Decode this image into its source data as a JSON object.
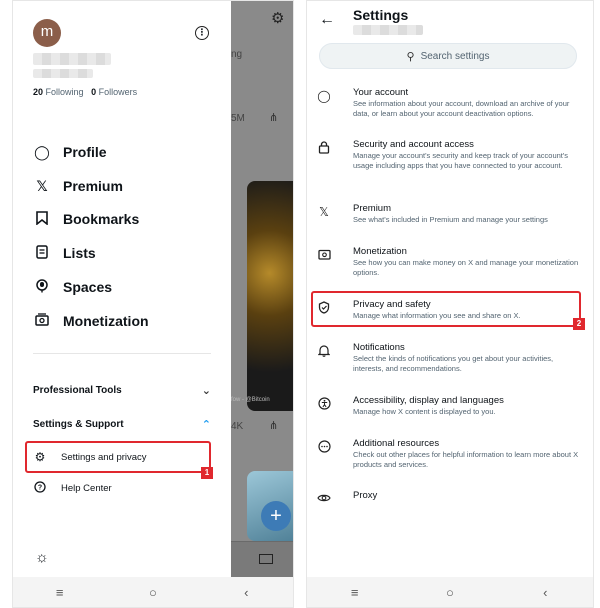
{
  "left": {
    "avatar_letter": "m",
    "following_count": "20",
    "following_label": "Following",
    "followers_count": "0",
    "followers_label": "Followers",
    "nav": [
      {
        "label": "Profile",
        "icon": "person-icon"
      },
      {
        "label": "Premium",
        "icon": "x-logo-icon"
      },
      {
        "label": "Bookmarks",
        "icon": "bookmark-icon"
      },
      {
        "label": "Lists",
        "icon": "list-icon"
      },
      {
        "label": "Spaces",
        "icon": "microphone-icon"
      },
      {
        "label": "Monetization",
        "icon": "money-icon"
      }
    ],
    "professional_tools": "Professional Tools",
    "settings_support": "Settings & Support",
    "settings_privacy": "Settings and privacy",
    "help_center": "Help Center",
    "badge": "1",
    "bg_text_ng": "ng",
    "bg_text_5m": "5M",
    "bg_text_4k": "4K",
    "bg_text_credit": "fow - @Bitcoin",
    "highlight_color": "#e0282e"
  },
  "right": {
    "title": "Settings",
    "search_placeholder": "Search settings",
    "badge": "2",
    "items": [
      {
        "title": "Your account",
        "desc": "See information about your account, download an archive of your data, or learn about your account deactivation options.",
        "icon": "person-icon"
      },
      {
        "title": "Security and account access",
        "desc": "Manage your account's security and keep track of your account's usage including apps that you have connected to your account.",
        "icon": "lock-icon"
      },
      {
        "title": "Premium",
        "desc": "See what's included in Premium and manage your settings",
        "icon": "x-logo-icon"
      },
      {
        "title": "Monetization",
        "desc": "See how you can make money on X and manage your monetization options.",
        "icon": "money-icon"
      },
      {
        "title": "Privacy and safety",
        "desc": "Manage what information you see and share on X.",
        "icon": "shield-icon"
      },
      {
        "title": "Notifications",
        "desc": "Select the kinds of notifications you get about your activities, interests, and recommendations.",
        "icon": "bell-icon"
      },
      {
        "title": "Accessibility, display and languages",
        "desc": "Manage how X content is displayed to you.",
        "icon": "accessibility-icon"
      },
      {
        "title": "Additional resources",
        "desc": "Check out other places for helpful information to learn more about X products and services.",
        "icon": "more-icon"
      },
      {
        "title": "Proxy",
        "desc": "",
        "icon": "eye-icon"
      }
    ]
  }
}
